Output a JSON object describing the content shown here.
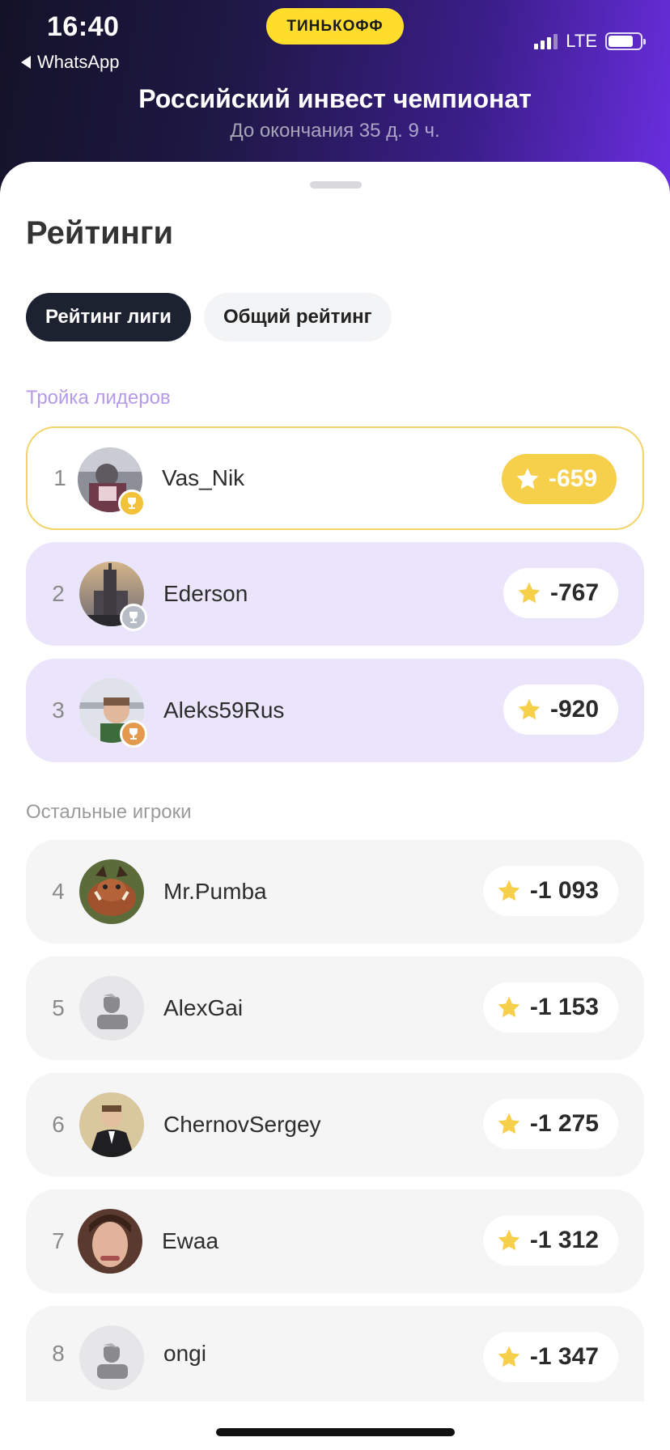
{
  "status_bar": {
    "time": "16:40",
    "back_app": "WhatsApp",
    "brand": "ТИНЬКОФФ",
    "network": "LTE"
  },
  "header": {
    "title": "Российский инвест чемпионат",
    "subtitle": "До окончания 35 д. 9 ч."
  },
  "sheet": {
    "title": "Рейтинги",
    "tabs": [
      {
        "label": "Рейтинг лиги",
        "active": true
      },
      {
        "label": "Общий рейтинг",
        "active": false
      }
    ],
    "leaders_label": "Тройка лидеров",
    "others_label": "Остальные игроки"
  },
  "leaders": [
    {
      "rank": "1",
      "name": "Vas_Nik",
      "score": "-659",
      "medal": "gold"
    },
    {
      "rank": "2",
      "name": "Ederson",
      "score": "-767",
      "medal": "silver"
    },
    {
      "rank": "3",
      "name": "Aleks59Rus",
      "score": "-920",
      "medal": "bronze"
    }
  ],
  "others": [
    {
      "rank": "4",
      "name": "Mr.Pumba",
      "score": "-1 093"
    },
    {
      "rank": "5",
      "name": "AlexGai",
      "score": "-1 153"
    },
    {
      "rank": "6",
      "name": "ChernovSergey",
      "score": "-1 275"
    },
    {
      "rank": "7",
      "name": "Ewaa",
      "score": "-1 312"
    },
    {
      "rank": "8",
      "name": "ongi",
      "score": "-1 347"
    }
  ],
  "colors": {
    "accent_yellow": "#f6cf4b",
    "leader_row": "#ebe5fb",
    "other_row": "#f5f5f6",
    "active_tab": "#1c2230"
  }
}
